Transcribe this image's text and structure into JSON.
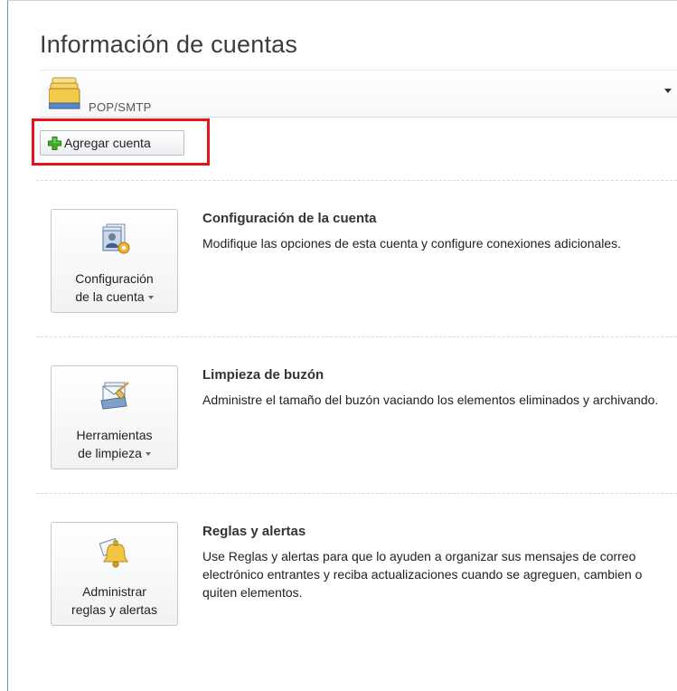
{
  "header": {
    "title": "Información de cuentas"
  },
  "account": {
    "type_label": "POP/SMTP",
    "folder_icon": "folder-stack-icon",
    "caret_icon": "chevron-down-icon"
  },
  "add_account": {
    "label": "Agregar cuenta",
    "icon": "green-plus-icon",
    "highlight_color": "#e8141c"
  },
  "sections": [
    {
      "button_line1": "Configuración",
      "button_line2": "de la cuenta",
      "icon": "account-settings-icon",
      "title": "Configuración de la cuenta",
      "description": "Modifique las opciones de esta cuenta y configure conexiones adicionales."
    },
    {
      "button_line1": "Herramientas",
      "button_line2": "de limpieza",
      "icon": "mailbox-cleanup-icon",
      "title": "Limpieza de buzón",
      "description": "Administre el tamaño del buzón vaciando los elementos eliminados y archivando."
    },
    {
      "button_line1": "Administrar",
      "button_line2": "reglas y alertas",
      "icon": "rules-alerts-icon",
      "title": "Reglas y alertas",
      "description": "Use Reglas y alertas para que lo ayuden a organizar sus mensajes de correo electrónico entrantes y reciba actualizaciones cuando se agreguen, cambien o quiten elementos."
    }
  ]
}
